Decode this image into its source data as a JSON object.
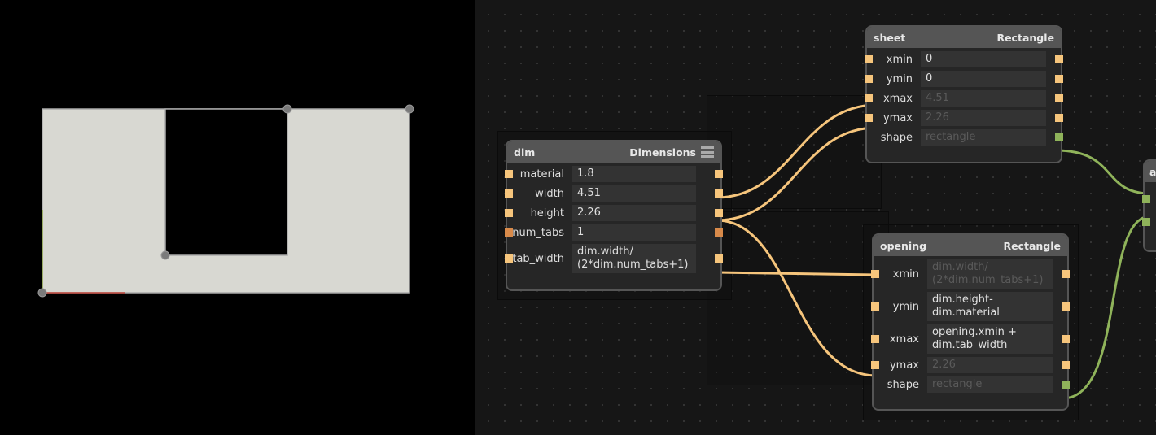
{
  "viewport": {
    "sheet": {
      "xmin": 0,
      "ymin": 0,
      "xmax": 4.51,
      "ymax": 2.26
    },
    "opening": {
      "xmin": 1.503,
      "ymin": 0.46,
      "xmax": 3.007,
      "ymax": 2.26
    },
    "colors": {
      "fill": "#d8d8d2",
      "outline": "#aaaaaa",
      "cutout": "#000000",
      "x_axis": "#c0453a",
      "y_axis": "#8fa84a",
      "handle": "#7a7a7a"
    }
  },
  "nodes": {
    "dim": {
      "name": "dim",
      "type": "Dimensions",
      "menu_icon": "hamburger-menu-icon",
      "rows": [
        {
          "label": "material",
          "value": "1.8"
        },
        {
          "label": "width",
          "value": "4.51"
        },
        {
          "label": "height",
          "value": "2.26"
        },
        {
          "label": "num_tabs",
          "value": "1"
        },
        {
          "label": "tab_width",
          "value": "dim.width/\n(2*dim.num_tabs+1)"
        }
      ]
    },
    "sheet": {
      "name": "sheet",
      "type": "Rectangle",
      "rows": [
        {
          "label": "xmin",
          "value": "0"
        },
        {
          "label": "ymin",
          "value": "0"
        },
        {
          "label": "xmax",
          "value": "4.51"
        },
        {
          "label": "ymax",
          "value": "2.26"
        },
        {
          "label": "shape",
          "value": "rectangle"
        }
      ]
    },
    "opening": {
      "name": "opening",
      "type": "Rectangle",
      "rows": [
        {
          "label": "xmin",
          "value": "dim.width/\n(2*dim.num_tabs+1)"
        },
        {
          "label": "ymin",
          "value": "dim.height-\ndim.material"
        },
        {
          "label": "xmax",
          "value": "opening.xmin +\ndim.tab_width"
        },
        {
          "label": "ymax",
          "value": "2.26"
        },
        {
          "label": "shape",
          "value": "rectangle"
        }
      ]
    },
    "partial": {
      "name": "a"
    }
  },
  "colors": {
    "wire_float": "#f6c57c",
    "wire_shape": "#8fb35a",
    "port_int": "#d88a4a"
  }
}
